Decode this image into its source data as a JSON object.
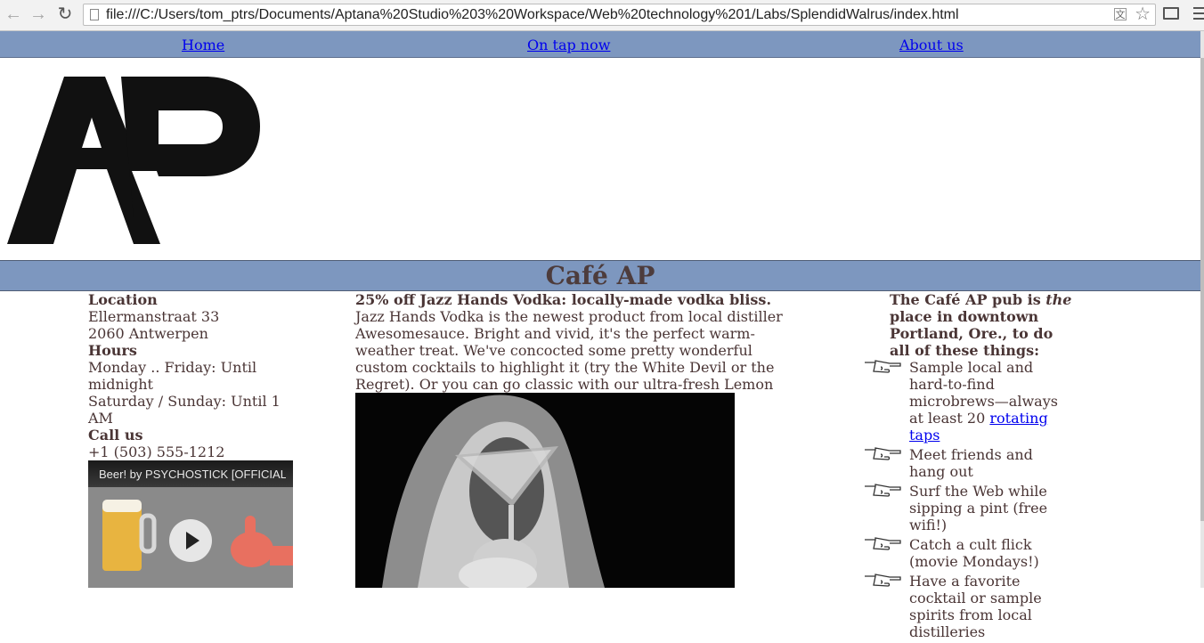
{
  "browser": {
    "url": "file:///C:/Users/tom_ptrs/Documents/Aptana%20Studio%203%20Workspace/Web%20technology%201/Labs/SplendidWalrus/index.html",
    "back_icon": "back-arrow-icon",
    "forward_icon": "forward-arrow-icon",
    "reload_icon": "reload-icon"
  },
  "nav": {
    "home": "Home",
    "on_tap": "On tap now",
    "about": "About us"
  },
  "logo": {
    "text": "AP"
  },
  "page_title": "Café AP",
  "left": {
    "location_heading": "Location",
    "address_1": "Ellermanstraat 33",
    "address_2": "2060 Antwerpen",
    "hours_heading": "Hours",
    "hours_1": "Monday .. Friday: Until midnight",
    "hours_2": "Saturday / Sunday: Until 1 AM",
    "call_heading": "Call us",
    "phone": "+1 (503) 555-1212",
    "video_title": "Beer! by PSYCHOSTICK [OFFICIAL"
  },
  "middle": {
    "headline": "25% off Jazz Hands Vodka: locally-made vodka bliss.",
    "body": "Jazz Hands Vodka is the newest product from local distiller Awesomesauce. Bright and vivid, it's the perfect warm-weather treat. We've concocted some pretty wonderful custom cocktails to highlight it (try the White Devil or the Regret). Or you can go classic with our ultra-fresh Lemon Drop (made with organic citrus)."
  },
  "right": {
    "intro_1": "The Café AP pub is ",
    "intro_em": "the",
    "intro_2": " place in downtown Portland, Ore., to do all of these things:",
    "items": [
      {
        "text": "Sample local and hard-to-find microbrews—always at least 20 ",
        "link": "rotating taps"
      },
      {
        "text": "Meet friends and hang out"
      },
      {
        "text": "Surf the Web while sipping a pint (free wifi!)"
      },
      {
        "text": "Catch a cult flick (movie Mondays!)"
      },
      {
        "text": "Have a favorite cocktail or sample spirits from local distilleries"
      }
    ]
  }
}
